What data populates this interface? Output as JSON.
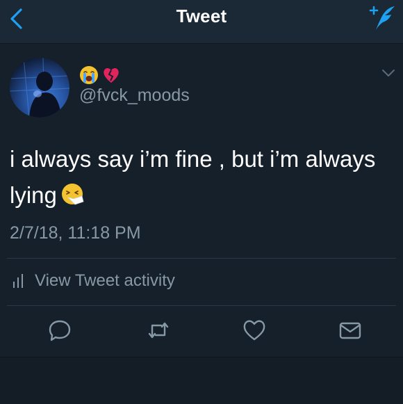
{
  "nav": {
    "title": "Tweet"
  },
  "tweet": {
    "handle": "@fvck_moods",
    "name_emojis": [
      "😭",
      "💔"
    ],
    "text_line1": "i always say i’m fine , but i’m always",
    "text_line2": "lying",
    "timestamp": "2/7/18, 11:18 PM"
  },
  "activity": {
    "label": "View Tweet activity"
  },
  "icons": {
    "back": "chevron-left-icon",
    "compose": "compose-feather-icon",
    "more": "chevron-down-icon",
    "reply": "reply-bubble-icon",
    "retweet": "retweet-icon",
    "like": "heart-icon",
    "dm": "envelope-icon",
    "activity": "bar-chart-icon"
  },
  "colors": {
    "accent": "#1da1f2",
    "background": "#15202b",
    "secondary_text": "#8899a6"
  }
}
